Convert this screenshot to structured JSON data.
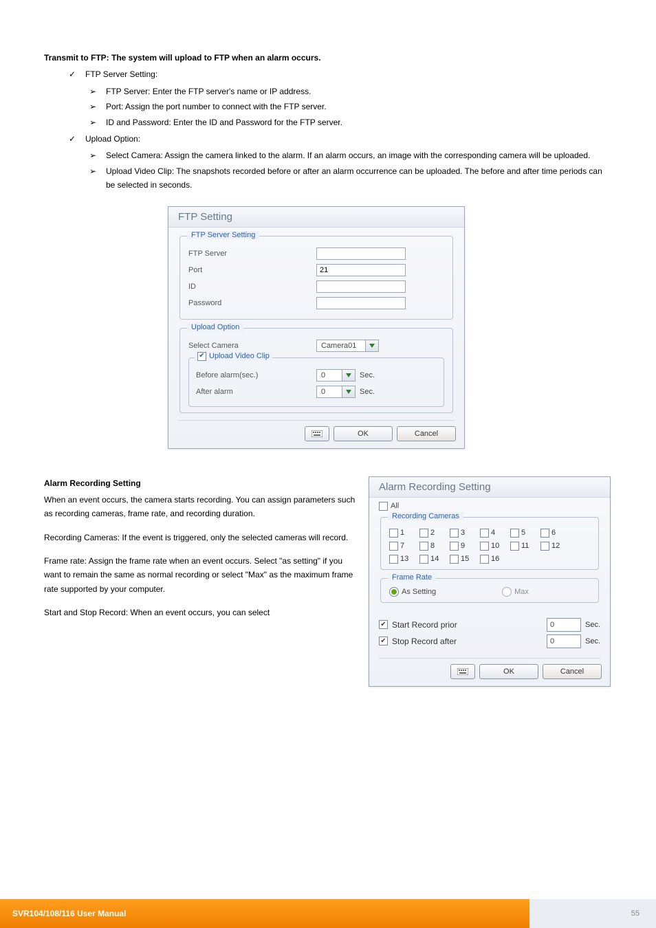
{
  "domain": "Document",
  "heading_transmit": "Transmit to FTP: The system will upload to FTP when an alarm occurs.",
  "ftp_setting_section": {
    "title": "FTP Server Setting:",
    "items": [
      "FTP Server: Enter the FTP server's name or IP address.",
      "Port: Assign the port number to connect with the FTP server.",
      "ID and Password: Enter the ID and Password for the FTP server."
    ]
  },
  "upload_option_section": {
    "title": "Upload Option:",
    "items": [
      "Select Camera: Assign the camera linked to the alarm. If an alarm occurs, an image with the corresponding camera will be uploaded.",
      "Upload Video Clip: The snapshots recorded before or after an alarm occurrence can be uploaded. The before and after time periods can be selected in seconds."
    ]
  },
  "ftp_dialog": {
    "title": "FTP Setting",
    "fieldset1_title": "FTP Server Setting",
    "rows": {
      "ftp_server_label": "FTP Server",
      "ftp_server_value": "",
      "port_label": "Port",
      "port_value": "21",
      "id_label": "ID",
      "id_value": "",
      "password_label": "Password",
      "password_value": ""
    },
    "fieldset2_title": "Upload Option",
    "select_camera_label": "Select Camera",
    "select_camera_value": "Camera01",
    "upload_clip_title": "Upload Video Clip",
    "upload_clip_checked": "✔",
    "before_label": "Before alarm(sec.)",
    "before_value": "0",
    "after_label": "After alarm",
    "after_value": "0",
    "sec_label": "Sec.",
    "ok": "OK",
    "cancel": "Cancel"
  },
  "alarm_section": {
    "heading": "Alarm Recording Setting",
    "intro": "When an event occurs, the camera starts recording. You can assign parameters such as recording cameras, frame rate, and recording duration.",
    "recording_cameras_text": "Recording Cameras: If the event is triggered, only the selected cameras will record.",
    "frame_rate_text": "Frame rate: Assign the frame rate when an event occurs. Select \"as setting\" if you want to remain the same as normal recording or select \"Max\" as the maximum frame rate supported by your computer.",
    "start_stop_text": "Start and Stop Record: When an event occurs, you can select"
  },
  "alarm_dialog": {
    "title": "Alarm Recording Setting",
    "all_label": "All",
    "recording_cameras_title": "Recording Cameras",
    "cameras": [
      "1",
      "2",
      "3",
      "4",
      "5",
      "6",
      "7",
      "8",
      "9",
      "10",
      "11",
      "12",
      "13",
      "14",
      "15",
      "16"
    ],
    "frame_rate_title": "Frame Rate",
    "as_setting_label": "As Setting",
    "max_label": "Max",
    "start_prior_label": "Start Record prior",
    "start_prior_value": "0",
    "stop_after_label": "Stop Record after",
    "stop_after_value": "0",
    "sec_label": "Sec.",
    "ok": "OK",
    "cancel": "Cancel",
    "start_checked": "✔",
    "stop_checked": "✔"
  },
  "footer": {
    "left": "SVR104/108/116 User Manual",
    "right": "55"
  }
}
